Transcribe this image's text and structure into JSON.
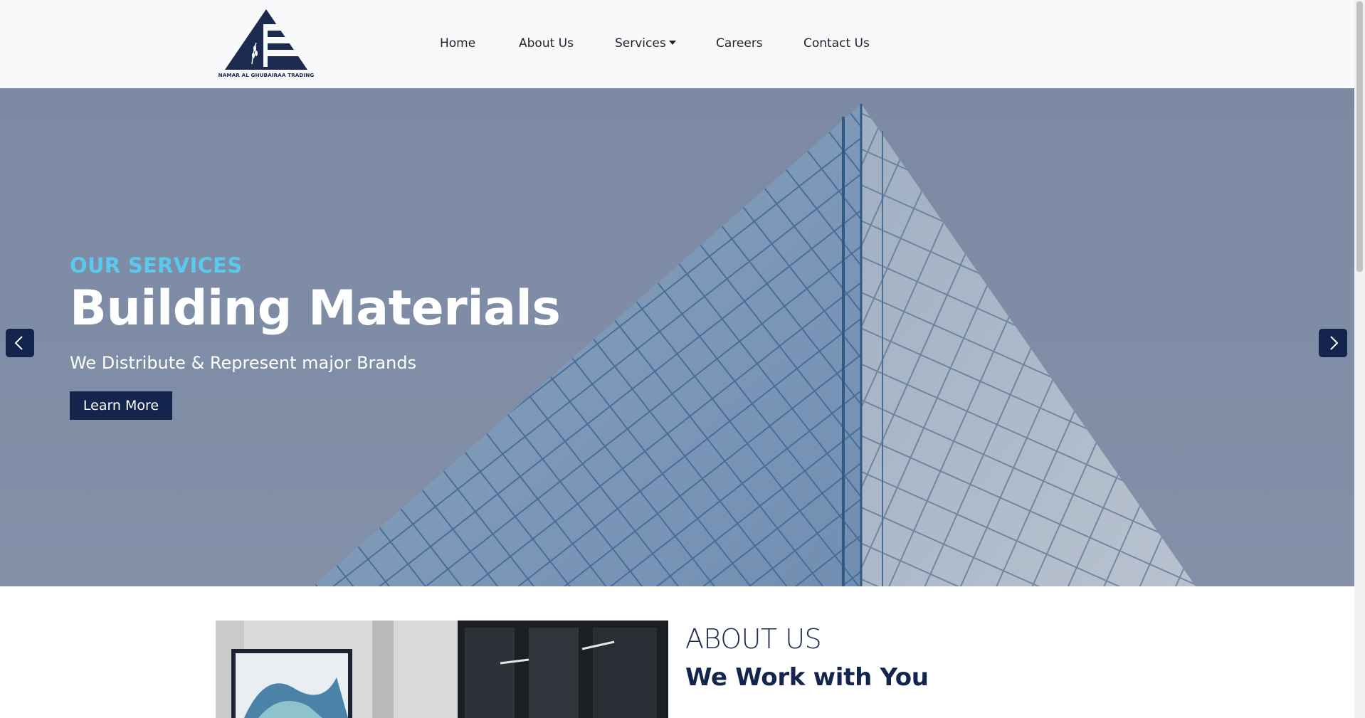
{
  "brand": {
    "logo_caption": "NAMAR AL GHUBAIRAA TRADING",
    "primary_color": "#13254d",
    "accent_color": "#5bc8ee"
  },
  "nav": {
    "items": [
      {
        "label": "Home"
      },
      {
        "label": "About Us"
      },
      {
        "label": "Services",
        "has_dropdown": true
      },
      {
        "label": "Careers"
      },
      {
        "label": "Contact Us"
      }
    ]
  },
  "hero": {
    "eyebrow": "OUR SERVICES",
    "title": "Building Materials",
    "subtitle": "We Distribute & Represent major Brands",
    "button_label": "Learn More",
    "prev_icon": "chevron-left-icon",
    "next_icon": "chevron-right-icon"
  },
  "about": {
    "heading": "ABOUT US",
    "subheading": "We Work with You"
  }
}
